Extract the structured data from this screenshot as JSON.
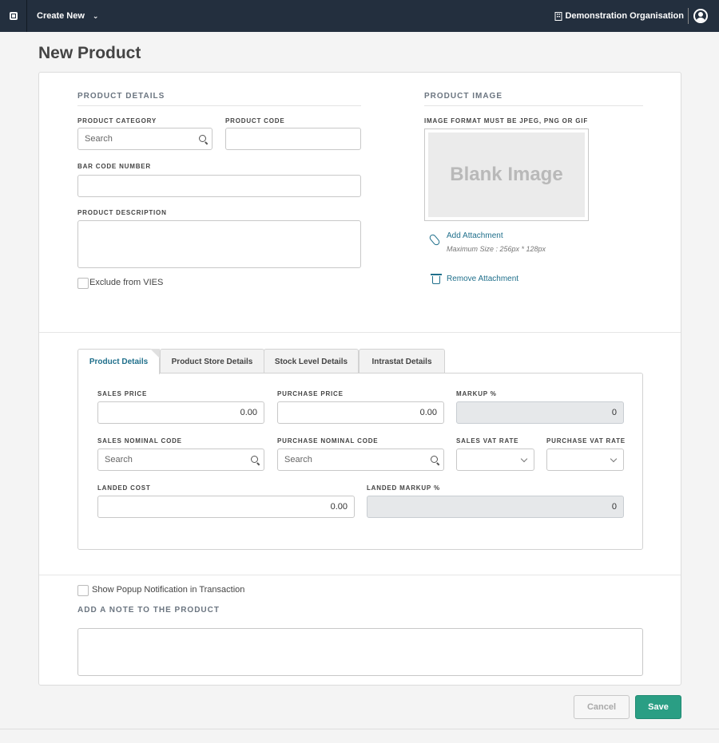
{
  "topbar": {
    "create_new": "Create New",
    "organisation": "Demonstration Organisation"
  },
  "page": {
    "title": "New Product"
  },
  "product_details": {
    "section_title": "PRODUCT DETAILS",
    "category_label": "PRODUCT CATEGORY",
    "category_placeholder": "Search",
    "code_label": "PRODUCT CODE",
    "code_value": "",
    "barcode_label": "BAR CODE NUMBER",
    "barcode_value": "",
    "description_label": "PRODUCT DESCRIPTION",
    "description_value": "",
    "exclude_vies_label": "Exclude from VIES",
    "exclude_vies_checked": false
  },
  "product_image": {
    "section_title": "PRODUCT IMAGE",
    "format_note": "IMAGE FORMAT MUST BE JPEG, PNG OR GIF",
    "blank_text": "Blank Image",
    "add_attachment": "Add Attachment",
    "max_size": "Maximum Size : 256px * 128px",
    "remove_attachment": "Remove Attachment"
  },
  "tabs": [
    {
      "label": "Product Details",
      "active": true
    },
    {
      "label": "Product Store Details",
      "active": false
    },
    {
      "label": "Stock Level Details",
      "active": false
    },
    {
      "label": "Intrastat Details",
      "active": false
    }
  ],
  "pricing": {
    "sales_price_label": "SALES PRICE",
    "sales_price": "0.00",
    "purchase_price_label": "PURCHASE PRICE",
    "purchase_price": "0.00",
    "markup_label": "MARKUP %",
    "markup": "0",
    "sales_nominal_label": "SALES NOMINAL CODE",
    "sales_nominal_placeholder": "Search",
    "purchase_nominal_label": "PURCHASE NOMINAL CODE",
    "purchase_nominal_placeholder": "Search",
    "sales_vat_label": "SALES VAT RATE",
    "sales_vat": "",
    "purchase_vat_label": "PURCHASE VAT RATE",
    "purchase_vat": "",
    "landed_cost_label": "LANDED COST",
    "landed_cost": "0.00",
    "landed_markup_label": "LANDED MARKUP %",
    "landed_markup": "0"
  },
  "notes": {
    "popup_label": "Show Popup Notification in Transaction",
    "popup_checked": false,
    "note_title": "ADD A NOTE TO THE PRODUCT",
    "note_value": ""
  },
  "actions": {
    "cancel": "Cancel",
    "save": "Save"
  },
  "colors": {
    "topbar": "#232f3e",
    "accent": "#1f6f8b",
    "save": "#2a9e84"
  }
}
